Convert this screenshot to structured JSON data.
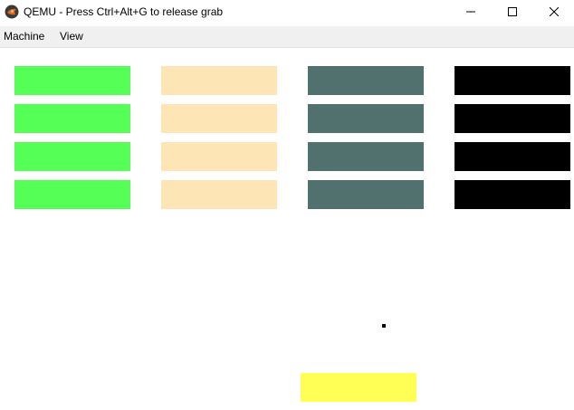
{
  "window": {
    "title": "QEMU - Press Ctrl+Alt+G to release grab",
    "icon": "qemu-logo-icon",
    "controls": [
      "minimize-icon",
      "maximize-icon",
      "close-icon"
    ]
  },
  "menubar": {
    "items": [
      {
        "label": "Machine"
      },
      {
        "label": "View"
      }
    ]
  },
  "game": {
    "type": "breakout",
    "brick_columns": [
      {
        "color": "#55ff55",
        "rows": 4
      },
      {
        "color": "#fde5b6",
        "rows": 4
      },
      {
        "color": "#51716e",
        "rows": 4
      },
      {
        "color": "#000000",
        "rows": 4
      }
    ],
    "ball_color": "#000000",
    "paddle_color": "#ffff55",
    "background": "#ffffff"
  }
}
